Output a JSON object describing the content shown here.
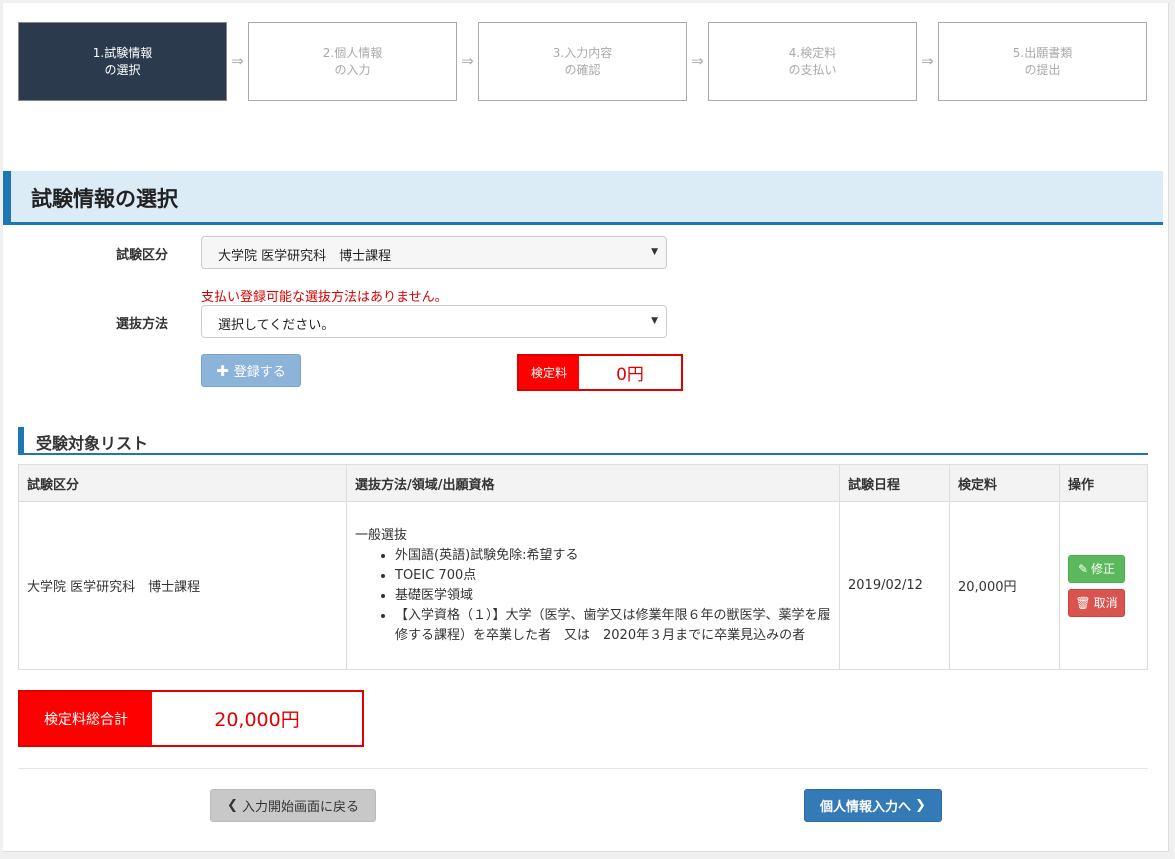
{
  "steps": [
    {
      "label": "1.試験情報\nの選択",
      "active": true
    },
    {
      "label": "2.個人情報\nの入力",
      "active": false
    },
    {
      "label": "3.入力内容\nの確認",
      "active": false
    },
    {
      "label": "4.検定料\nの支払い",
      "active": false
    },
    {
      "label": "5.出願書類\nの提出",
      "active": false
    }
  ],
  "step_arrow": "⇒",
  "section": {
    "title": "試験情報の選択"
  },
  "form": {
    "exam_category_label": "試験区分",
    "exam_category_value": "大学院 医学研究科　博士課程",
    "error_message": "支払い登録可能な選抜方法はありません。",
    "selection_method_label": "選抜方法",
    "selection_method_value": "選択してください。",
    "register_button": "登録する",
    "fee_label": "検定料",
    "fee_value": "0円"
  },
  "list": {
    "title": "受験対象リスト",
    "columns": [
      "試験区分",
      "選抜方法/領域/出願資格",
      "試験日程",
      "検定料",
      "操作"
    ],
    "rows": [
      {
        "category": "大学院 医学研究科　博士課程",
        "method_title": "一般選抜",
        "method_items": [
          "外国語(英語)試験免除:希望する",
          "TOEIC 700点",
          "基礎医学領域",
          "【入学資格（１）】大学（医学、歯学又は修業年限６年の獣医学、薬学を履修する課程）を卒業した者　又は　2020年３月までに卒業見込みの者"
        ],
        "date": "2019/02/12",
        "fee": "20,000円",
        "edit_label": "修正",
        "cancel_label": "取消"
      }
    ]
  },
  "total": {
    "label": "検定料総合計",
    "value": "20,000円"
  },
  "nav": {
    "back_button": "入力開始画面に戻る",
    "next_button": "個人情報入力へ"
  },
  "colors": {
    "accent": "#1e77b5",
    "error": "#ff0000",
    "step_active": "#2b3b4d"
  }
}
